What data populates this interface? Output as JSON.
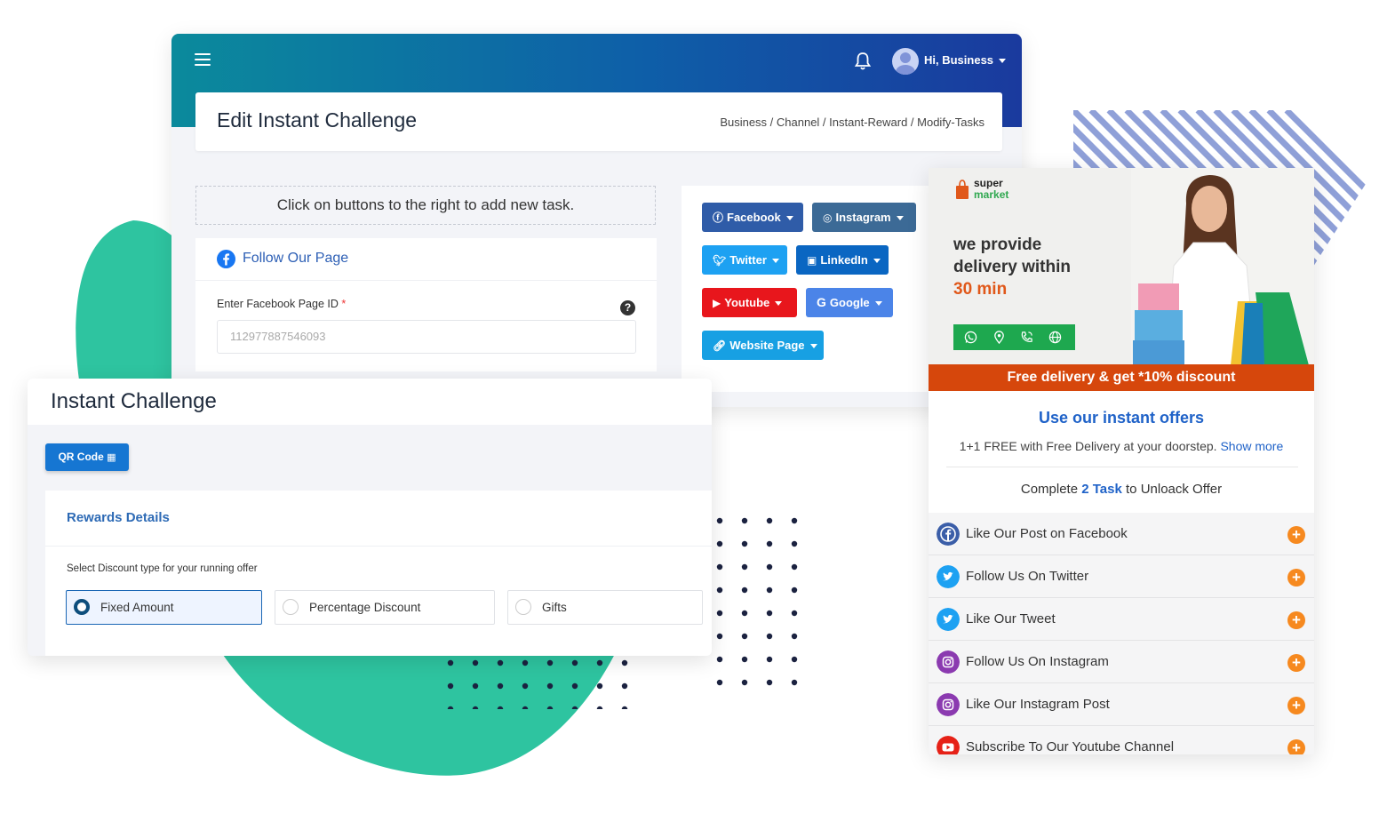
{
  "header": {
    "user_label": "Hi, Business"
  },
  "page": {
    "title": "Edit Instant Challenge",
    "breadcrumb": "Business / Channel / Instant-Reward / Modify-Tasks"
  },
  "task_builder": {
    "hint": "Click on buttons to the right to add new task.",
    "task_title": "Follow Our Page",
    "field_label": "Enter Facebook Page ID",
    "required_mark": "*",
    "help_glyph": "?",
    "field_value": "112977887546093"
  },
  "social_buttons": [
    {
      "label": "Facebook",
      "icon": "facebook-icon",
      "color": "#2f5ca8"
    },
    {
      "label": "Instagram",
      "icon": "instagram-icon",
      "color": "#3c6a96"
    },
    {
      "label": "Twitter",
      "icon": "twitter-icon",
      "color": "#1da1f2"
    },
    {
      "label": "LinkedIn",
      "icon": "linkedin-icon",
      "color": "#0a66c2"
    },
    {
      "label": "Youtube",
      "icon": "youtube-icon",
      "color": "#e8161c"
    },
    {
      "label": "Google",
      "icon": "google-icon",
      "color": "#4b84e8"
    },
    {
      "label": "Website Page",
      "icon": "link-icon",
      "color": "#17a0e3"
    }
  ],
  "instant_challenge": {
    "title": "Instant Challenge",
    "qr_button": "QR Code",
    "rewards_title": "Rewards Details",
    "discount_label": "Select Discount type for your running offer",
    "options": [
      "Fixed Amount",
      "Percentage Discount",
      "Gifts"
    ],
    "selected": "Fixed Amount"
  },
  "offer": {
    "logo_top": "super",
    "logo_bottom": "market",
    "banner_line1": "we provide",
    "banner_line2": "delivery within",
    "banner_line3": "30 min",
    "promo_bar": "Free delivery & get *10% discount",
    "title": "Use our instant offers",
    "description": "1+1 FREE with Free Delivery at your doorstep.",
    "show_more": "Show more",
    "unlock_prefix": "Complete",
    "unlock_count": "2 Task",
    "unlock_suffix": "to Unloack Offer",
    "tasks": [
      {
        "label": "Like Our Post on Facebook",
        "icon": "facebook-icon"
      },
      {
        "label": "Follow Us On Twitter",
        "icon": "twitter-icon"
      },
      {
        "label": "Like Our Tweet",
        "icon": "twitter-icon"
      },
      {
        "label": "Follow Us On Instagram",
        "icon": "instagram-icon"
      },
      {
        "label": "Like Our Instagram Post",
        "icon": "instagram-icon"
      },
      {
        "label": "Subscribe To Our Youtube Channel",
        "icon": "youtube-icon"
      }
    ]
  },
  "colors": {
    "header_gradient_start": "#0b8a9c",
    "header_gradient_end": "#1a3a9e",
    "blob": "#2ec4a0",
    "accent_blue": "#1f62c8",
    "promo_orange": "#d6470c",
    "plus_orange": "#f6891f"
  }
}
